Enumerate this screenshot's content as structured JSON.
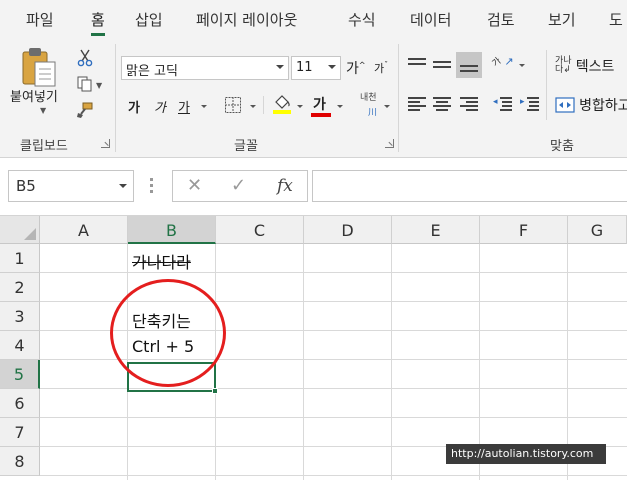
{
  "ribbon": {
    "tabs": [
      {
        "label": "파일"
      },
      {
        "label": "홈"
      },
      {
        "label": "삽입"
      },
      {
        "label": "페이지 레이아웃"
      },
      {
        "label": "수식"
      },
      {
        "label": "데이터"
      },
      {
        "label": "검토"
      },
      {
        "label": "보기"
      },
      {
        "label": "도"
      }
    ],
    "active_tab": "홈",
    "accent_color": "#217346",
    "clipboard": {
      "paste_label": "붙여넣기",
      "group_label": "클립보드"
    },
    "font": {
      "font_name": "맑은 고딕",
      "font_size": "11",
      "grow_label": "가",
      "shrink_label": "가",
      "bold_label": "가",
      "italic_label": "가",
      "underline_label": "가",
      "font_color_label": "가",
      "phonetic_label": "내천",
      "group_label": "글꼴",
      "fill_color": "#ffff00",
      "font_color": "#e00000"
    },
    "alignment": {
      "orientation_label": "가",
      "wrap_label": "텍스트",
      "merge_label": "병합하고",
      "group_label": "맞춤"
    }
  },
  "formula_bar": {
    "name_box": "B5",
    "cancel_symbol": "✕",
    "enter_symbol": "✓",
    "fx_label": "fx",
    "formula": ""
  },
  "sheet": {
    "columns": [
      "A",
      "B",
      "C",
      "D",
      "E",
      "F",
      "G"
    ],
    "rows": [
      "1",
      "2",
      "3",
      "4",
      "5",
      "6",
      "7",
      "8"
    ],
    "selected_cell": "B5",
    "cells": {
      "B1": "가나다라",
      "B3": "단축키는",
      "B4": "Ctrl + 5"
    },
    "annotation_color": "#e41e1e"
  },
  "watermark": "http://autolian.tistory.com"
}
